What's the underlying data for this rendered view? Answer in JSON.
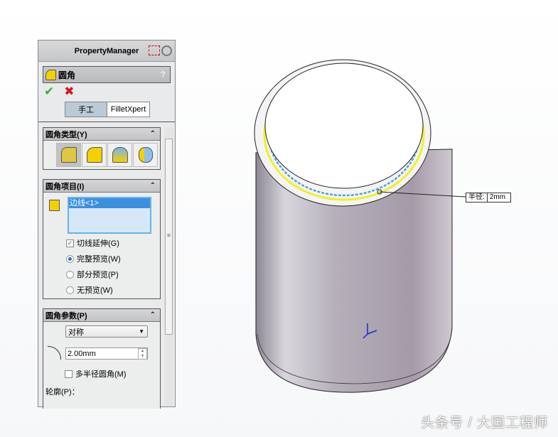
{
  "panel": {
    "title": "PropertyManager",
    "feature": "圆角",
    "help": "?",
    "ok": "✔",
    "cancel": "✖",
    "tabs": [
      "手工",
      "FilletXpert"
    ],
    "fillet_type": {
      "title": "圆角类型(Y)"
    },
    "fillet_items": {
      "title": "圆角项目(I)",
      "selection": "边线<1>",
      "tangent": "切线延伸(G)",
      "tangent_checked": true,
      "preview": [
        {
          "label": "完整预览(W)",
          "selected": true
        },
        {
          "label": "部分预览(P)",
          "selected": false
        },
        {
          "label": "无预览(W)",
          "selected": false
        }
      ]
    },
    "fillet_params": {
      "title": "圆角参数(P)",
      "method": "对称",
      "radius": "2.00mm",
      "multi_radius": "多半径圆角(M)",
      "multi_checked": false,
      "profile": "轮廓(P)："
    }
  },
  "viewport": {
    "dim_label": "半径:",
    "dim_value": "2mm"
  },
  "watermark": "头条号 / 大国工程师"
}
